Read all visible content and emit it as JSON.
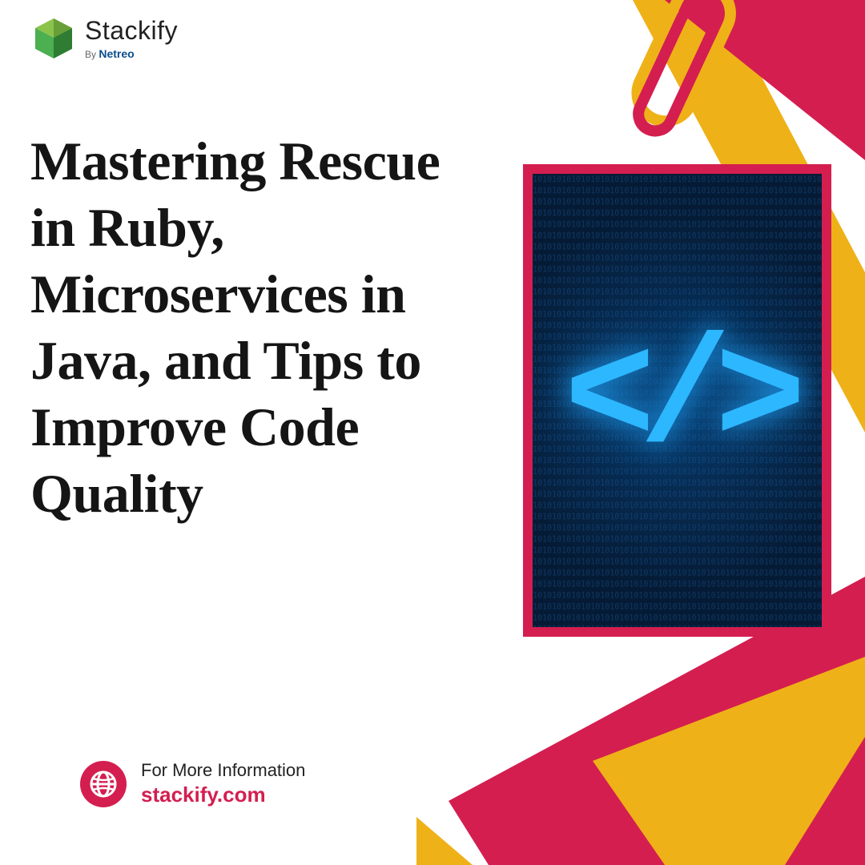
{
  "logo": {
    "brand": "Stackify",
    "byline_prefix": "By ",
    "byline_brand": "Netreo"
  },
  "headline": "Mastering Rescue in Ruby, Microservices in Java, and Tips to Improve Code Quality",
  "info": {
    "label": "For More Information",
    "url": "stackify.com"
  },
  "colors": {
    "accent": "#d41e50",
    "gold": "#efb118",
    "dark": "#151515",
    "blue_glow": "#2db7ff"
  },
  "image": {
    "alt": "code-brackets-binary",
    "symbol": "</>"
  }
}
